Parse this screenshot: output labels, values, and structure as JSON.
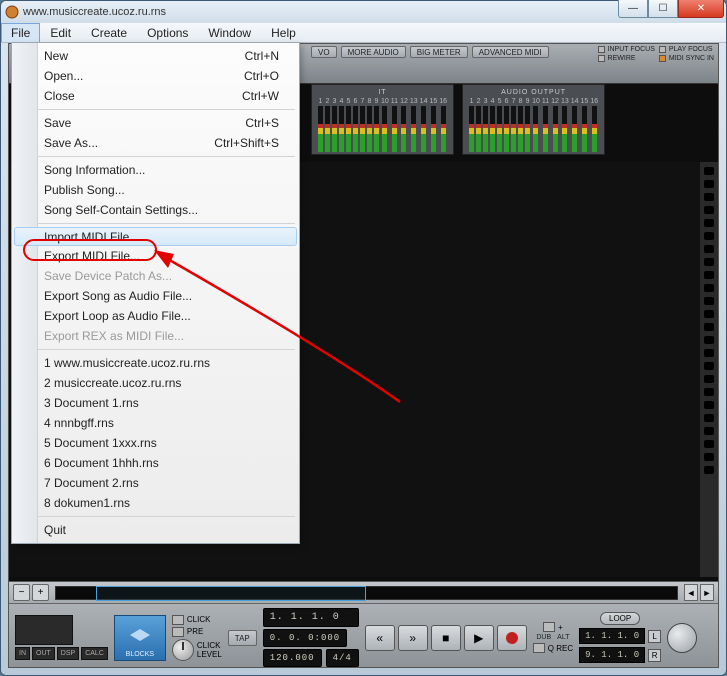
{
  "window": {
    "title": "www.musiccreate.ucoz.ru.rns"
  },
  "menubar": [
    "File",
    "Edit",
    "Create",
    "Options",
    "Window",
    "Help"
  ],
  "file_menu": {
    "groups": [
      [
        {
          "label": "New",
          "shortcut": "Ctrl+N"
        },
        {
          "label": "Open...",
          "shortcut": "Ctrl+O"
        },
        {
          "label": "Close",
          "shortcut": "Ctrl+W"
        }
      ],
      [
        {
          "label": "Save",
          "shortcut": "Ctrl+S"
        },
        {
          "label": "Save As...",
          "shortcut": "Ctrl+Shift+S"
        }
      ],
      [
        {
          "label": "Song Information..."
        },
        {
          "label": "Publish Song..."
        },
        {
          "label": "Song Self-Contain Settings..."
        }
      ],
      [
        {
          "label": "Import MIDI File...",
          "highlight": true
        },
        {
          "label": "Export MIDI File..."
        },
        {
          "label": "Save Device Patch As...",
          "disabled": true
        },
        {
          "label": "Export Song as Audio File..."
        },
        {
          "label": "Export Loop as Audio File..."
        },
        {
          "label": "Export REX as MIDI File...",
          "disabled": true
        }
      ],
      [
        {
          "label": "1 www.musiccreate.ucoz.ru.rns"
        },
        {
          "label": "2 musiccreate.ucoz.ru.rns"
        },
        {
          "label": "3 Document 1.rns"
        },
        {
          "label": "4 nnnbgff.rns"
        },
        {
          "label": "5 Document 1xxx.rns"
        },
        {
          "label": "6 Document 1hhh.rns"
        },
        {
          "label": "7 Document 2.rns"
        },
        {
          "label": "8 dokumen1.rns"
        }
      ],
      [
        {
          "label": "Quit"
        }
      ]
    ]
  },
  "toolbar": {
    "buttons": [
      "VO",
      "MORE AUDIO",
      "BIG METER",
      "ADVANCED MIDI"
    ],
    "status": {
      "input_focus": "INPUT FOCUS",
      "play_focus": "PLAY FOCUS",
      "rewire": "REWIRE",
      "midi_sync": "MIDI SYNC IN"
    }
  },
  "meters": {
    "group1_title": "IT",
    "group2_title": "AUDIO OUTPUT",
    "channels": [
      "1",
      "2",
      "3",
      "4",
      "5",
      "6",
      "7",
      "8",
      "9",
      "10",
      "11",
      "12",
      "13",
      "14",
      "15",
      "16"
    ]
  },
  "transport": {
    "io": [
      "IN",
      "OUT",
      "DSP",
      "CALC"
    ],
    "blocks": "BLOCKS",
    "click": "CLICK",
    "pre": "PRE",
    "click_level": "CLICK\nLEVEL",
    "tap": "TAP",
    "pos_main": "1. 1. 1.  0",
    "time": "0. 0. 0:000",
    "tempo": "120.000",
    "sig": "4/4",
    "dub": "DUB",
    "alt": "ALT",
    "qrec": "Q REC",
    "loop": "LOOP",
    "loop_start": "1. 1. 1.  0",
    "loop_end": "9. 1. 1.  0",
    "L": "L",
    "R": "R",
    "minus": "−",
    "plus": "+"
  }
}
